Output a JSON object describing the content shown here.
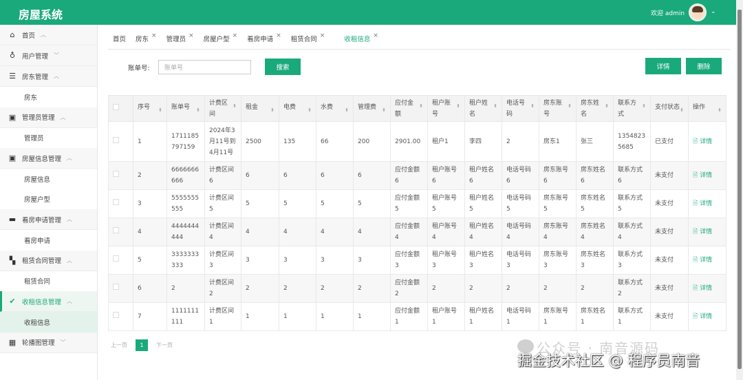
{
  "header": {
    "title": "房屋系统",
    "welcome": "欢迎 admin"
  },
  "sidebar": [
    {
      "label": "首页",
      "icon": "home-icon",
      "glyph": "⌂",
      "chev": "^",
      "children": []
    },
    {
      "label": "用户管理",
      "icon": "user-icon",
      "glyph": "♁",
      "chev": "v",
      "children": []
    },
    {
      "label": "房东管理",
      "icon": "list-icon",
      "glyph": "☰",
      "chev": "^",
      "children": [
        "房东"
      ]
    },
    {
      "label": "管理员管理",
      "icon": "gift-icon",
      "glyph": "▣",
      "chev": "^",
      "children": [
        "管理员"
      ]
    },
    {
      "label": "房屋信息管理",
      "icon": "gift-icon",
      "glyph": "▣",
      "chev": "^",
      "children": [
        "房屋信息",
        "房屋户型"
      ]
    },
    {
      "label": "看房申请管理",
      "icon": "card-icon",
      "glyph": "▬",
      "chev": "^",
      "children": [
        "看房申请"
      ]
    },
    {
      "label": "租赁合同管理",
      "icon": "layout-icon",
      "glyph": "▚",
      "chev": "^",
      "children": [
        "租赁合同"
      ]
    },
    {
      "label": "收租信息管理",
      "icon": "check-circle-icon",
      "glyph": "✔",
      "chev": "^",
      "active": true,
      "children": [
        "收租信息"
      ]
    },
    {
      "label": "轮播图管理",
      "icon": "grid-icon",
      "glyph": "▦",
      "chev": "v",
      "children": []
    }
  ],
  "tabs": [
    {
      "label": "首页",
      "closable": false
    },
    {
      "label": "房东",
      "closable": true
    },
    {
      "label": "管理员",
      "closable": true
    },
    {
      "label": "房屋户型",
      "closable": true
    },
    {
      "label": "看房申请",
      "closable": true
    },
    {
      "label": "租赁合同",
      "closable": true
    },
    {
      "label": "收租信息",
      "closable": true,
      "active": true
    }
  ],
  "search": {
    "label": "账单号:",
    "placeholder": "账单号",
    "button": "搜索"
  },
  "actions": {
    "detail": "详情",
    "delete": "删除"
  },
  "table": {
    "columns": [
      "序号",
      "账单号",
      "计费区间",
      "租金",
      "电费",
      "水费",
      "管理费",
      "应付金额",
      "租户账号",
      "租户姓名",
      "电话号码",
      "房东账号",
      "房东姓名",
      "联系方式",
      "支付状态",
      "操作"
    ],
    "rows": [
      [
        "1",
        "1711185797159",
        "2024年3月11号到4月11号",
        "2500",
        "135",
        "66",
        "200",
        "2901.00",
        "租户1",
        "李四",
        "2",
        "房东1",
        "张三",
        "13548235685",
        "已支付"
      ],
      [
        "2",
        "6666666666",
        "计费区间6",
        "6",
        "6",
        "6",
        "6",
        "应付金额6",
        "租户账号6",
        "租户姓名6",
        "电话号码6",
        "房东账号6",
        "房东姓名6",
        "联系方式6",
        "未支付"
      ],
      [
        "3",
        "5555555555",
        "计费区间5",
        "5",
        "5",
        "5",
        "5",
        "应付金额5",
        "租户账号5",
        "租户姓名5",
        "电话号码5",
        "房东账号5",
        "房东姓名5",
        "联系方式5",
        "未支付"
      ],
      [
        "4",
        "4444444444",
        "计费区间4",
        "4",
        "4",
        "4",
        "4",
        "应付金额4",
        "租户账号4",
        "租户姓名4",
        "电话号码4",
        "房东账号4",
        "房东姓名4",
        "联系方式4",
        "未支付"
      ],
      [
        "5",
        "3333333333",
        "计费区间3",
        "3",
        "3",
        "3",
        "3",
        "应付金额3",
        "租户账号3",
        "租户姓名3",
        "电话号码3",
        "房东账号3",
        "房东姓名3",
        "联系方式3",
        "未支付"
      ],
      [
        "6",
        "2",
        "计费区间2",
        "2",
        "2",
        "2",
        "2",
        "应付金额2",
        "2",
        "2",
        "2",
        "2",
        "2",
        "联系方式2",
        "未支付"
      ],
      [
        "7",
        "1111111111",
        "计费区间1",
        "1",
        "1",
        "1",
        "1",
        "应付金额1",
        "租户账号1",
        "租户姓名1",
        "电话号码1",
        "房东账号1",
        "房东姓名1",
        "联系方式1",
        "未支付"
      ]
    ],
    "row_action": "详情"
  },
  "pagination": {
    "prev": "上一页",
    "current": "1",
    "next": "下一页"
  },
  "watermark": {
    "line1": "公众号 · 南音源码",
    "line2": "掘金技术社区 @ 程序员南音"
  },
  "colors": {
    "primary": "#1aa97b"
  }
}
